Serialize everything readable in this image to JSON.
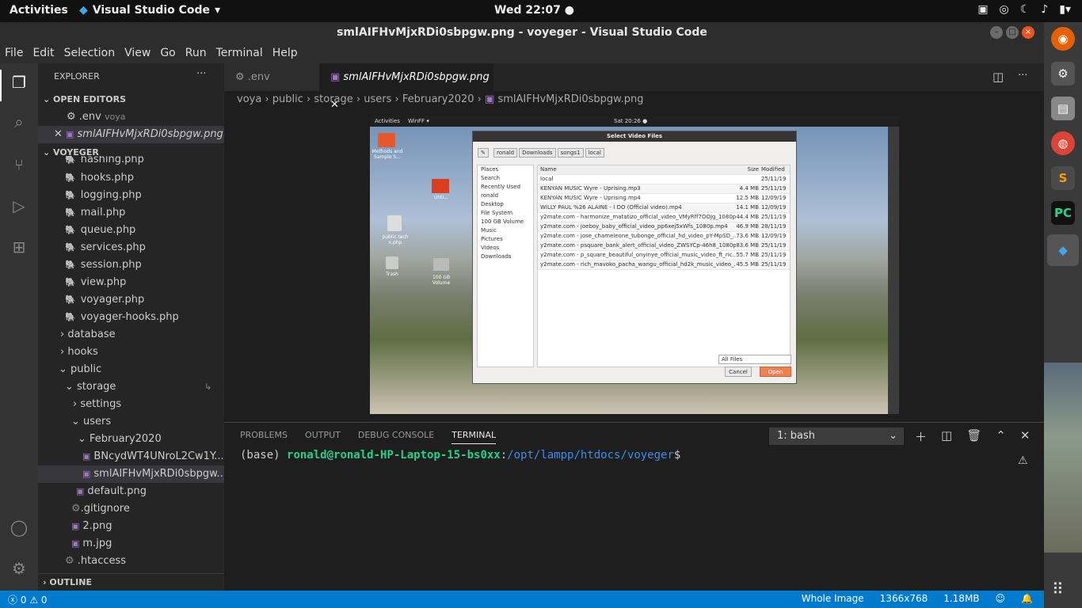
{
  "gnome": {
    "activities": "Activities",
    "app_name": "Visual Studio Code",
    "clock": "Wed 22:07"
  },
  "window": {
    "title": "smlAIFHvMjxRDi0sbpgw.png - voyeger - Visual Studio Code"
  },
  "menu": [
    "File",
    "Edit",
    "Selection",
    "View",
    "Go",
    "Run",
    "Terminal",
    "Help"
  ],
  "sidebar": {
    "title": "EXPLORER",
    "open_editors_label": "OPEN EDITORS",
    "open_editors": [
      {
        "name": ".env",
        "hint": "voya"
      },
      {
        "name": "smlAIFHvMjxRDi0sbpgw.png",
        "hint": ""
      }
    ],
    "project_label": "VOYEGER",
    "files": [
      "hashing.php",
      "hooks.php",
      "logging.php",
      "mail.php",
      "queue.php",
      "services.php",
      "session.php",
      "view.php",
      "voyager.php",
      "voyager-hooks.php"
    ],
    "folders": {
      "database": "database",
      "hooks": "hooks",
      "public": "public",
      "storage": "storage",
      "settings": "settings",
      "users": "users",
      "february": "February2020"
    },
    "images": {
      "bn": "BNcydWT4UNroL2Cw1Y...",
      "sml": "smlAIFHvMjxRDi0sbpgw....",
      "default": "default.png"
    },
    "root_files": {
      "gitignore": ".gitignore",
      "two": "2.png",
      "m": "m.jpg",
      "htaccess": ".htaccess"
    },
    "outline": "OUTLINE"
  },
  "tabs": [
    {
      "label": ".env"
    },
    {
      "label": "smlAIFHvMjxRDi0sbpgw.png"
    }
  ],
  "breadcrumbs": [
    "voya",
    "public",
    "storage",
    "users",
    "February2020",
    "smlAIFHvMjxRDi0sbpgw.png"
  ],
  "preview": {
    "topbar_left": "Activities",
    "topbar_app": "WinFF ▾",
    "topbar_clock": "Sat 20:26 ●",
    "desktop_icons": [
      "Methods and Sample S...",
      "Unti...",
      "public.tech x.php",
      "Trash",
      "100 GB Volume"
    ],
    "dialog_title": "Select Video Files",
    "path": [
      "ronald",
      "Downloads",
      "songs1",
      "local"
    ],
    "places": [
      "Places",
      "Search",
      "Recently Used",
      "ronald",
      "Desktop",
      "File System",
      "100 GB Volume",
      "Music",
      "Pictures",
      "Videos",
      "Downloads"
    ],
    "file_headers": {
      "name": "Name",
      "size": "Size",
      "modified": "Modified"
    },
    "files": [
      {
        "n": "local",
        "s": "",
        "m": "25/11/19"
      },
      {
        "n": "KENYAN MUSIC Wyre - Uprising.mp3",
        "s": "4.4 MB",
        "m": "25/11/19"
      },
      {
        "n": "KENYAN MUSIC Wyre - Uprising.mp4",
        "s": "12.5 MB",
        "m": "12/09/19"
      },
      {
        "n": "WILLY PAUL %26 ALAINE - I DO (Official video).mp4",
        "s": "14.1 MB",
        "m": "12/09/19"
      },
      {
        "n": "y2mate.com - harmonize_matatizo_official_video_VMyRff7OOJg_1080p...",
        "s": "44.4 MB",
        "m": "25/11/19"
      },
      {
        "n": "y2mate.com - joeboy_baby_official_video_pp6xej5xWfs_1080p.mp4",
        "s": "46.9 MB",
        "m": "28/11/19"
      },
      {
        "n": "y2mate.com - jose_chameleone_tubonge_official_hd_video_pY-MpSD_...",
        "s": "73.6 MB",
        "m": "12/09/19"
      },
      {
        "n": "y2mate.com - psquare_bank_alert_official_video_ZWSYCp-46h8_1080p...",
        "s": "83.6 MB",
        "m": "25/11/19"
      },
      {
        "n": "y2mate.com - p_square_beautiful_onyinye_official_music_video_ft_ric...",
        "s": "55.7 MB",
        "m": "25/11/19"
      },
      {
        "n": "y2mate.com - rich_mavoko_pacha_wangu_official_hd2k_music_video_...",
        "s": "45.5 MB",
        "m": "25/11/19"
      }
    ],
    "filter": "All Files",
    "cancel": "Cancel",
    "open": "Open"
  },
  "panel": {
    "tabs": [
      "PROBLEMS",
      "OUTPUT",
      "DEBUG CONSOLE",
      "TERMINAL"
    ],
    "active_tab": "TERMINAL",
    "shell": "1: bash",
    "prompt_env": "(base) ",
    "prompt_user": "ronald@ronald-HP-Laptop-15-bs0xx",
    "prompt_colon": ":",
    "prompt_path": "/opt/lampp/htdocs/voyeger",
    "prompt_end": "$"
  },
  "status": {
    "errors": "0",
    "warnings": "0",
    "view": "Whole Image",
    "dims": "1366x768",
    "size": "1.18MB"
  },
  "colors": {
    "statusbar": "#007acc",
    "accent": "#e95420",
    "terminal_user": "#23d18b",
    "terminal_path": "#3b8eea"
  }
}
